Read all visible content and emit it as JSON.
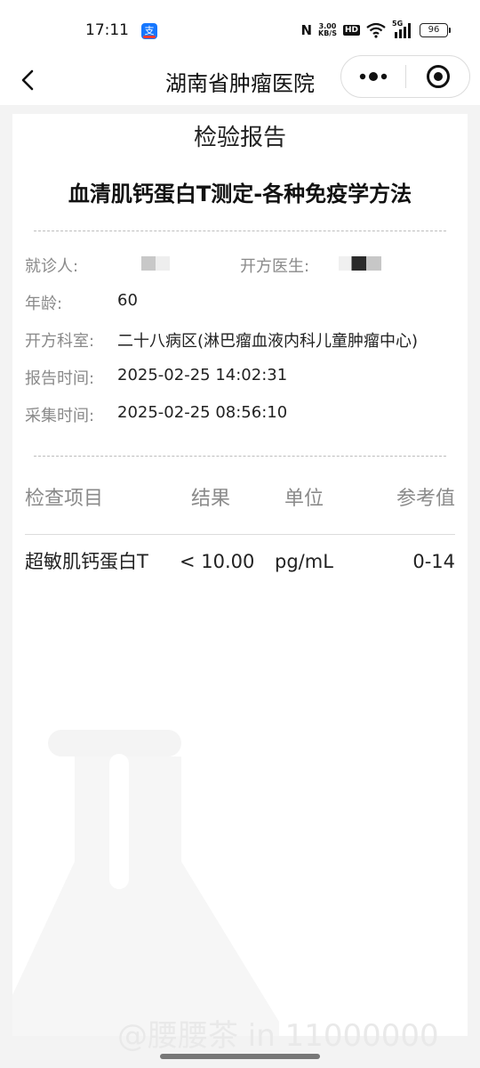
{
  "status_bar": {
    "time": "17:11",
    "app_icon": "alipay-icon",
    "nfc": "N",
    "net_speed_value": "3.00",
    "net_speed_unit": "KB/S",
    "hd": "HD",
    "signal_label": "5G",
    "battery": "96"
  },
  "nav": {
    "title": "湖南省肿瘤医院",
    "back_icon": "chevron-left-icon",
    "more_icon": "more-dots-icon",
    "close_icon": "target-circle-icon"
  },
  "report": {
    "header": "检验报告",
    "test_name": "血清肌钙蛋白T测定-各种免疫学方法",
    "patient_label": "就诊人:",
    "doctor_label": "开方医生:",
    "age_label": "年龄:",
    "age_value": "60",
    "dept_label": "开方科室:",
    "dept_value": "二十八病区(淋巴瘤血液内科儿童肿瘤中心)",
    "report_time_label": "报告时间:",
    "report_time_value": "2025-02-25 14:02:31",
    "collect_time_label": "采集时间:",
    "collect_time_value": "2025-02-25 08:56:10"
  },
  "table": {
    "headers": [
      "检查项目",
      "结果",
      "单位",
      "参考值"
    ],
    "rows": [
      {
        "item": "超敏肌钙蛋白T",
        "result": "< 10.00",
        "unit": "pg/mL",
        "reference": "0-14"
      }
    ]
  },
  "watermark": {
    "text": "@腰腰茶 in 11000000",
    "icon": "flask-icon"
  },
  "colors": {
    "background": "#f3f3f3",
    "card": "#ffffff",
    "label_gray": "#8a8a8a",
    "text_dark": "#222222"
  }
}
